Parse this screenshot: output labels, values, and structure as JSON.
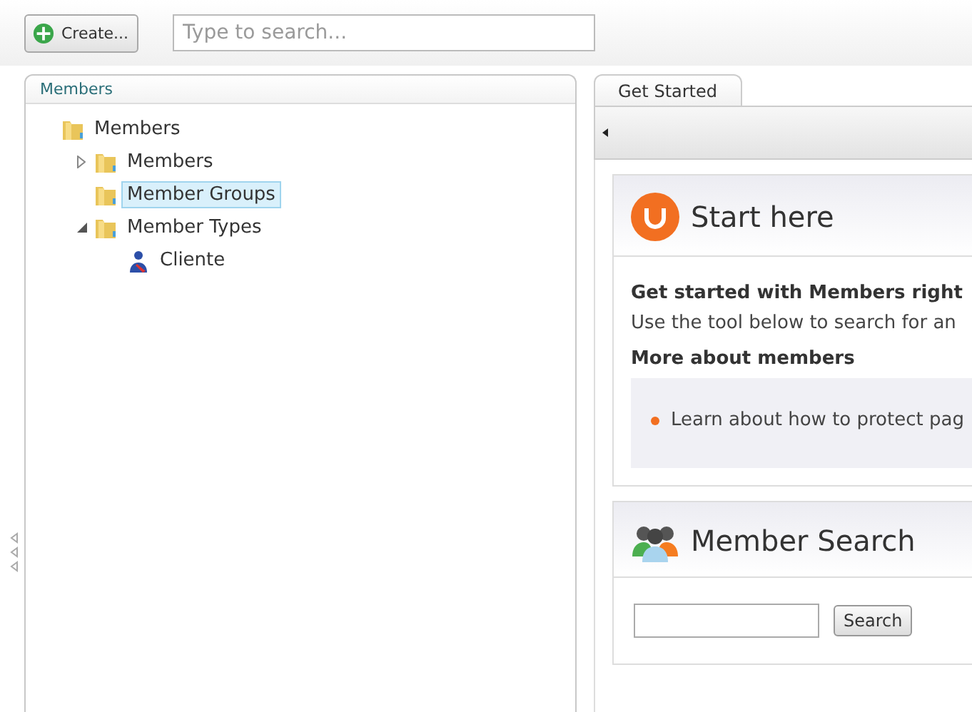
{
  "toolbar": {
    "create_button": "Create...",
    "search": {
      "placeholder": "Type to search..."
    }
  },
  "tree_panel": {
    "title": "Members",
    "nodes": [
      {
        "label": "Members",
        "kind": "folder",
        "selected": false,
        "children": [
          {
            "label": "Members",
            "kind": "folder",
            "selected": false,
            "expanded": false
          },
          {
            "label": "Member Groups",
            "kind": "folder",
            "selected": true
          },
          {
            "label": "Member Types",
            "kind": "folder",
            "selected": false,
            "expanded": true,
            "children": [
              {
                "label": "Cliente",
                "kind": "member-type",
                "selected": false
              }
            ]
          }
        ]
      }
    ]
  },
  "tabs": [
    {
      "label": "Get Started",
      "selected": true
    }
  ],
  "start_card": {
    "title": "Start here",
    "heading": "Get started with Members right",
    "text": "Use the tool below to search for an",
    "subheading": "More about members",
    "links": [
      "Learn about how to protect pag"
    ]
  },
  "search_card": {
    "title": "Member Search",
    "button": "Search"
  }
}
